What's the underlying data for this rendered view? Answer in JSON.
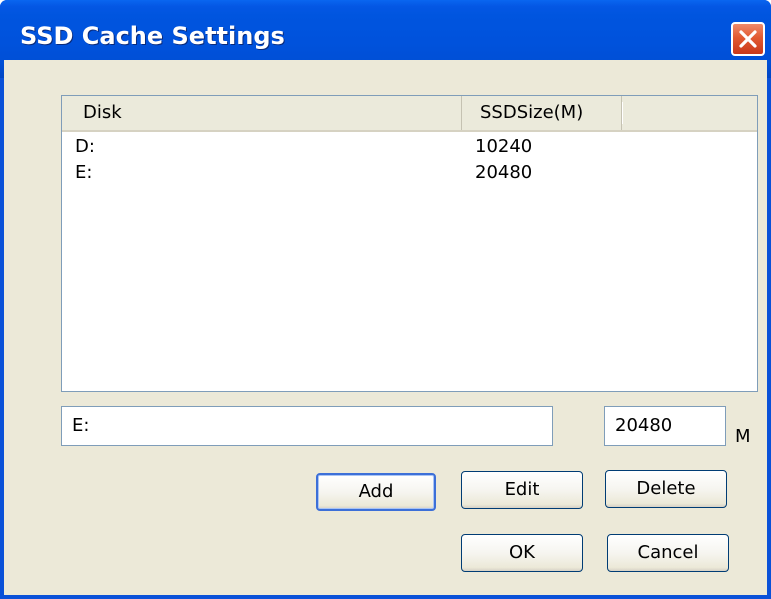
{
  "window": {
    "title": "SSD Cache Settings"
  },
  "list": {
    "columns": [
      "Disk",
      "SSDSize(M)"
    ],
    "rows": [
      {
        "disk": "D:",
        "size": "10240"
      },
      {
        "disk": "E:",
        "size": "20480"
      }
    ]
  },
  "inputs": {
    "disk_value": "E:",
    "size_value": "20480",
    "unit": "M"
  },
  "buttons": {
    "add": "Add",
    "edit": "Edit",
    "delete": "Delete",
    "ok": "OK",
    "cancel": "Cancel"
  }
}
